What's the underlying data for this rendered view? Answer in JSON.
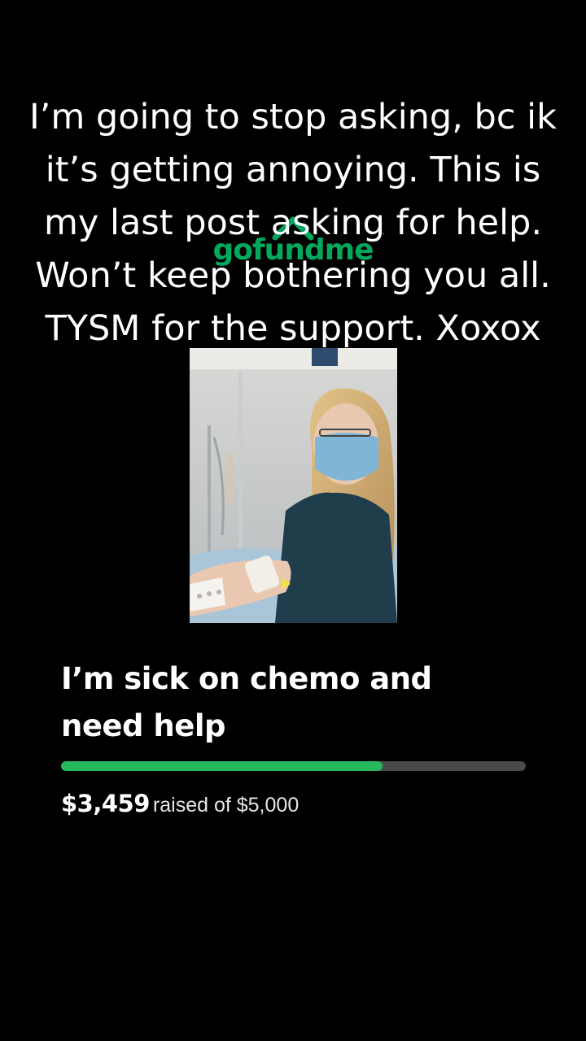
{
  "overlay": {
    "caption": "I’m going to stop asking, bc ik it’s getting annoying. This is my last post asking for help. Won’t keep bothering you all. TYSM for the support. Xoxox"
  },
  "fundraiser": {
    "brand": "gofundme",
    "brand_mark": "™",
    "brand_color": "#02a95c",
    "title": "I’m sick on chemo and need help",
    "raised": "$3,459",
    "goal_text": "raised of $5,000",
    "progress_fraction": 0.6918,
    "progress_color": "#25b95c",
    "track_color": "#4a4a4a"
  },
  "icons": {
    "logo_mark": "gofundme-arrow-icon"
  }
}
